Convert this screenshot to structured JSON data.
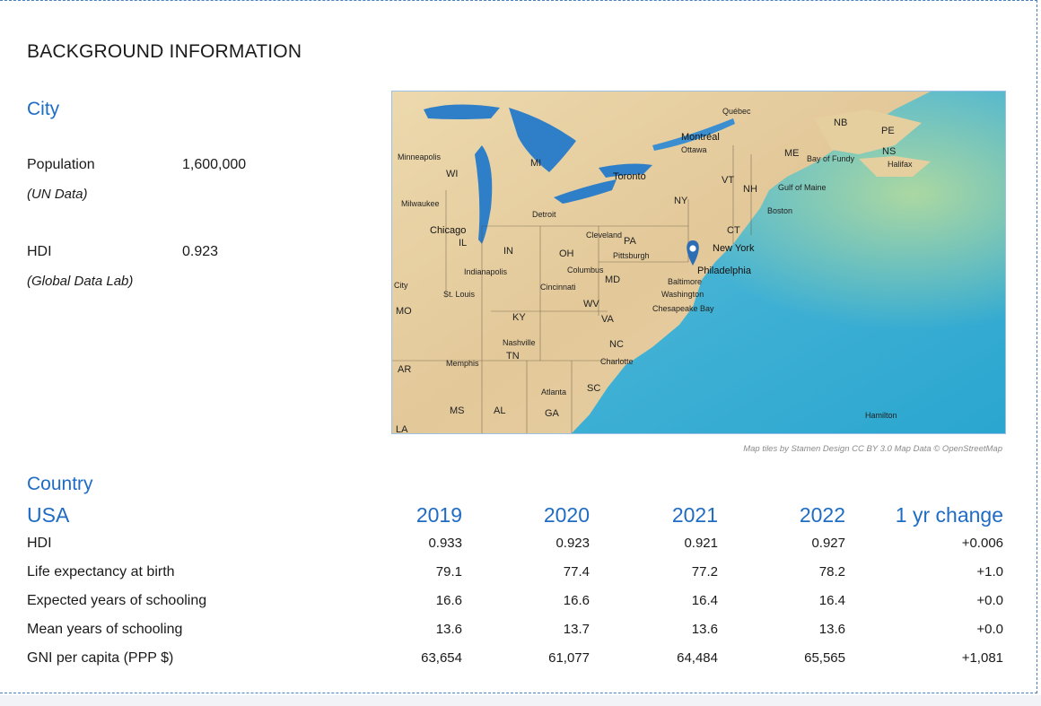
{
  "section_title": "BACKGROUND INFORMATION",
  "city": {
    "heading": "City",
    "population": {
      "label": "Population",
      "source": "(UN Data)",
      "value": "1,600,000"
    },
    "hdi": {
      "label": "HDI",
      "source": "(Global Data Lab)",
      "value": "0.923"
    }
  },
  "map": {
    "credit": "Map tiles by Stamen Design CC BY 3.0 Map Data © OpenStreetMap",
    "pin": "map-pin-icon",
    "state_labels": [
      "NB",
      "PE",
      "NS",
      "ME",
      "WI",
      "MI",
      "VT",
      "NH",
      "NY",
      "CT",
      "IL",
      "IN",
      "OH",
      "PA",
      "MD",
      "WV",
      "KY",
      "VA",
      "NC",
      "TN",
      "SC",
      "AR",
      "MS",
      "AL",
      "GA",
      "MO",
      "LA"
    ],
    "place_labels": [
      "Québec",
      "Montréal",
      "Ottawa",
      "Halifax",
      "Minneapolis",
      "Toronto",
      "Milwaukee",
      "Detroit",
      "Boston",
      "Chicago",
      "Cleveland",
      "New York",
      "Pittsburgh",
      "Philadelphia",
      "Indianapolis",
      "Columbus",
      "Baltimore",
      "Washington",
      "St. Louis",
      "Cincinnati",
      "Nashville",
      "Charlotte",
      "Memphis",
      "Atlanta",
      "Hamilton",
      "Gulf of Maine",
      "Bay of Fundy",
      "Chesapeake Bay",
      "City"
    ],
    "selected_place": "Philadelphia"
  },
  "country": {
    "heading": "Country",
    "name": "USA",
    "columns": [
      "2019",
      "2020",
      "2021",
      "2022",
      "1 yr change"
    ],
    "rows": [
      {
        "label": "HDI",
        "values": [
          "0.933",
          "0.923",
          "0.921",
          "0.927",
          "+0.006"
        ]
      },
      {
        "label": "Life expectancy at birth",
        "values": [
          "79.1",
          "77.4",
          "77.2",
          "78.2",
          "+1.0"
        ]
      },
      {
        "label": "Expected years of schooling",
        "values": [
          "16.6",
          "16.6",
          "16.4",
          "16.4",
          "+0.0"
        ]
      },
      {
        "label": "Mean years of schooling",
        "values": [
          "13.6",
          "13.7",
          "13.6",
          "13.6",
          "+0.0"
        ]
      },
      {
        "label": "GNI per capita (PPP $)",
        "values": [
          "63,654",
          "61,077",
          "64,484",
          "65,565",
          "+1,081"
        ]
      }
    ]
  },
  "colors": {
    "accent": "#1f6cc4",
    "border": "#4a7fc0",
    "water": "#4bb3d6",
    "land": "#e8d3a6"
  }
}
